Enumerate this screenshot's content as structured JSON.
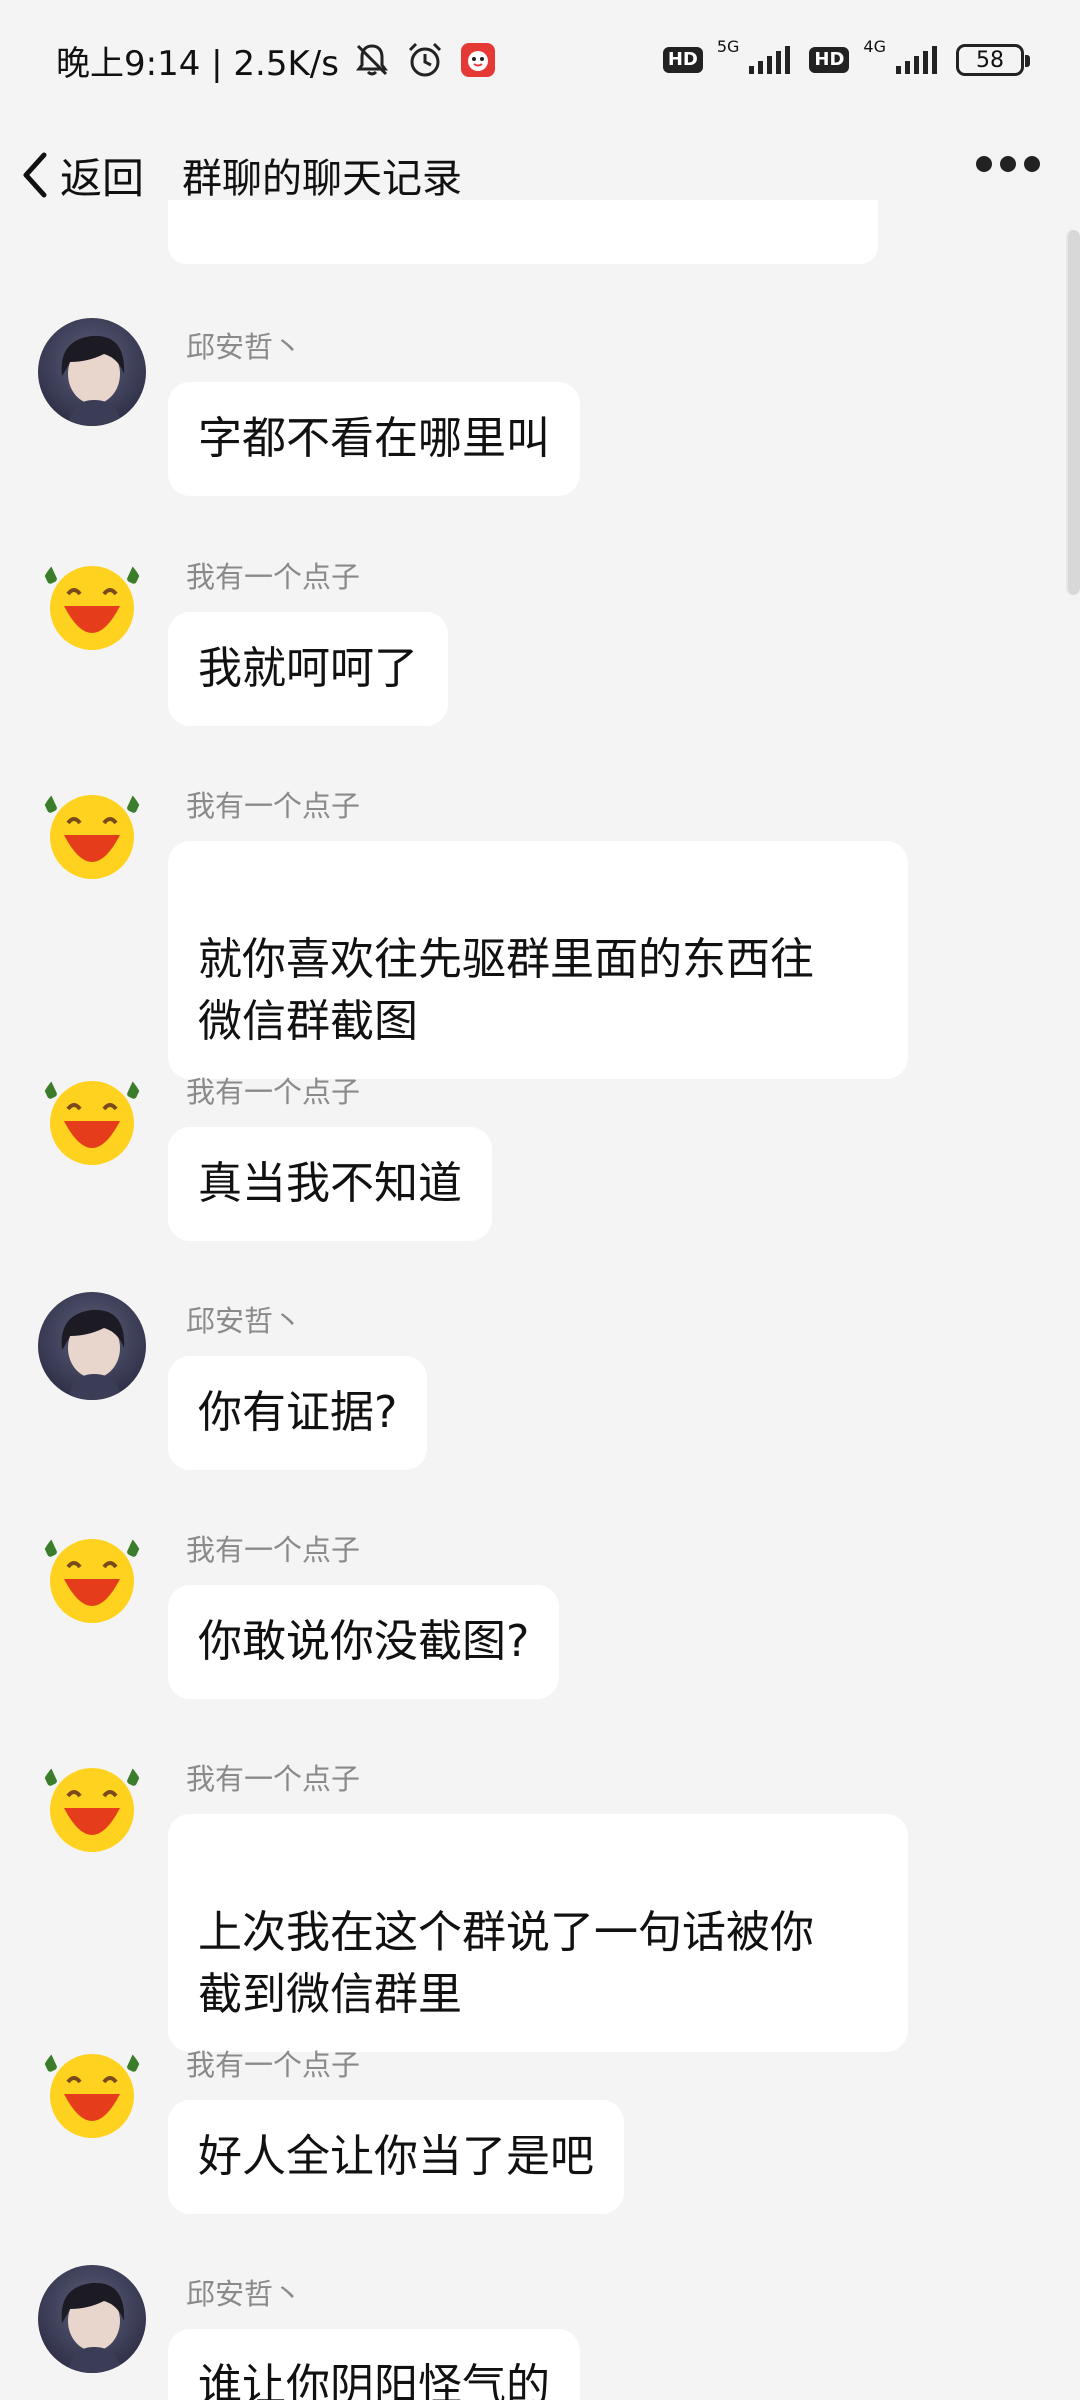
{
  "status_bar": {
    "time_network": "晚上9:14 | 2.5K/s",
    "icons": [
      "mute-bell-icon",
      "alarm-icon",
      "app-notification-icon"
    ],
    "hd1": "HD",
    "net1": "5G",
    "hd2": "HD",
    "net2": "4G",
    "battery": "58"
  },
  "header": {
    "back_label": "返回",
    "title": "群聊的聊天记录"
  },
  "messages": [
    {
      "sender": "邱安哲丶",
      "avatar": "dark-hair-avatar",
      "text": "字都不看在哪里叫"
    },
    {
      "sender": "我有一个点子",
      "avatar": "laughing-emoji-avatar",
      "text": "我就呵呵了"
    },
    {
      "sender": "我有一个点子",
      "avatar": "laughing-emoji-avatar",
      "text": "就你喜欢往先驱群里面的东西往\n微信群截图"
    },
    {
      "sender": "我有一个点子",
      "avatar": "laughing-emoji-avatar",
      "text": "真当我不知道"
    },
    {
      "sender": "邱安哲丶",
      "avatar": "dark-hair-avatar",
      "text": "你有证据?"
    },
    {
      "sender": "我有一个点子",
      "avatar": "laughing-emoji-avatar",
      "text": "你敢说你没截图?"
    },
    {
      "sender": "我有一个点子",
      "avatar": "laughing-emoji-avatar",
      "text": "上次我在这个群说了一句话被你\n截到微信群里"
    },
    {
      "sender": "我有一个点子",
      "avatar": "laughing-emoji-avatar",
      "text": "好人全让你当了是吧"
    },
    {
      "sender": "邱安哲丶",
      "avatar": "dark-hair-avatar",
      "text": "谁让你阴阳怪气的"
    }
  ],
  "colors": {
    "background": "#f4f4f4",
    "bubble": "#ffffff",
    "sender_name": "#8a8a8a"
  }
}
